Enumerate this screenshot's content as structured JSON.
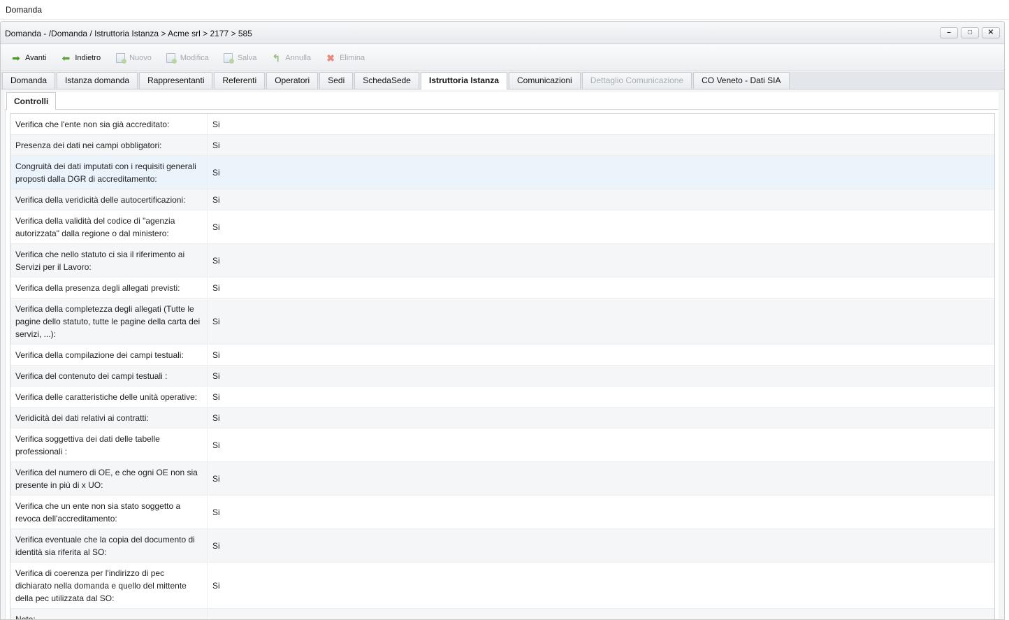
{
  "topbar": {
    "title": "Domanda"
  },
  "window": {
    "title": "Domanda - /Domanda / Istruttoria Istanza > Acme srl > 2177 > 585",
    "controls": {
      "minimize": "–",
      "maximize": "□",
      "close": "✕"
    }
  },
  "toolbar": {
    "avanti": "Avanti",
    "indietro": "Indietro",
    "nuovo": "Nuovo",
    "modifica": "Modifica",
    "salva": "Salva",
    "annulla": "Annulla",
    "elimina": "Elimina"
  },
  "tabs": [
    {
      "label": "Domanda",
      "state": "normal"
    },
    {
      "label": "Istanza domanda",
      "state": "normal"
    },
    {
      "label": "Rappresentanti",
      "state": "normal"
    },
    {
      "label": "Referenti",
      "state": "normal"
    },
    {
      "label": "Operatori",
      "state": "normal"
    },
    {
      "label": "Sedi",
      "state": "normal"
    },
    {
      "label": "SchedaSede",
      "state": "normal"
    },
    {
      "label": "Istruttoria Istanza",
      "state": "active"
    },
    {
      "label": "Comunicazioni",
      "state": "normal"
    },
    {
      "label": "Dettaglio Comunicazione",
      "state": "disabled"
    },
    {
      "label": "CO Veneto - Dati SIA",
      "state": "normal"
    }
  ],
  "subtab": {
    "label": "Controlli"
  },
  "controls": [
    {
      "label": "Verifica che l'ente non sia già accreditato:",
      "value": "Si"
    },
    {
      "label": "Presenza dei dati nei campi obbligatori:",
      "value": "Si"
    },
    {
      "label": "Congruità dei dati imputati con i requisiti generali proposti dalla DGR di accreditamento:",
      "value": "Si"
    },
    {
      "label": "Verifica della veridicità delle autocertificazioni:",
      "value": "Si"
    },
    {
      "label": "Verifica della validità del codice di \"agenzia autorizzata\" dalla regione o dal ministero:",
      "value": "Si"
    },
    {
      "label": "Verifica che nello statuto ci sia il riferimento ai Servizi per il Lavoro:",
      "value": "Si"
    },
    {
      "label": "Verifica della presenza degli allegati previsti:",
      "value": "Si"
    },
    {
      "label": "Verifica della completezza degli allegati (Tutte le pagine dello statuto, tutte le pagine della carta dei servizi, ...):",
      "value": "Si"
    },
    {
      "label": "Verifica della compilazione dei campi testuali:",
      "value": "Si"
    },
    {
      "label": "Verifica del contenuto dei campi testuali :",
      "value": "Si"
    },
    {
      "label": "Verifica delle caratteristiche delle unità operative:",
      "value": "Si"
    },
    {
      "label": "Veridicità dei dati relativi ai contratti:",
      "value": "Si"
    },
    {
      "label": "Verifica soggettiva dei dati delle tabelle professionali :",
      "value": "Si"
    },
    {
      "label": "Verifica del numero di OE, e che ogni OE non sia presente in più di x UO:",
      "value": "Si"
    },
    {
      "label": "Verifica che un ente non sia stato soggetto a revoca dell'accreditamento:",
      "value": "Si"
    },
    {
      "label": "Verifica eventuale che la copia del documento di identità sia riferita al SO:",
      "value": "Si"
    },
    {
      "label": "Verifica di coerenza per l'indirizzo di pec dichiarato nella domanda e quello del mittente della pec utilizzata dal SO:",
      "value": "Si"
    },
    {
      "label": "Note:",
      "value": ""
    }
  ]
}
